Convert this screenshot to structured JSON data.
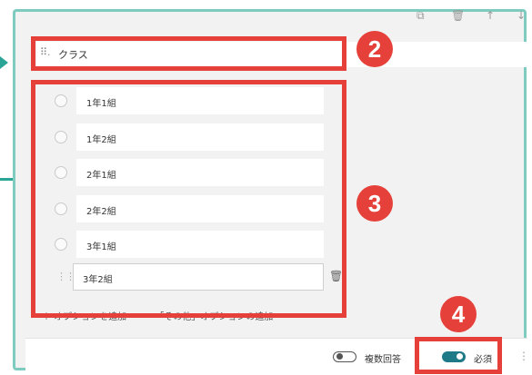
{
  "question": {
    "title": "クラス"
  },
  "options": [
    {
      "label": "1年1組"
    },
    {
      "label": "1年2組"
    },
    {
      "label": "2年1組"
    },
    {
      "label": "2年2組"
    },
    {
      "label": "3年1組"
    },
    {
      "label": "3年2組"
    }
  ],
  "add_option": {
    "add_label": "オプションを追加",
    "other_label": "「その他」オプションの追加"
  },
  "footer": {
    "multiple_answers_label": "複数回答",
    "required_label": "必須",
    "multiple_answers_on": false,
    "required_on": true
  },
  "callouts": {
    "badge2": "2",
    "badge3": "3",
    "badge4": "4"
  },
  "colors": {
    "accent_red": "#e5403a",
    "frame_teal": "#7ecbbf",
    "toggle_on": "#1e7a86"
  }
}
